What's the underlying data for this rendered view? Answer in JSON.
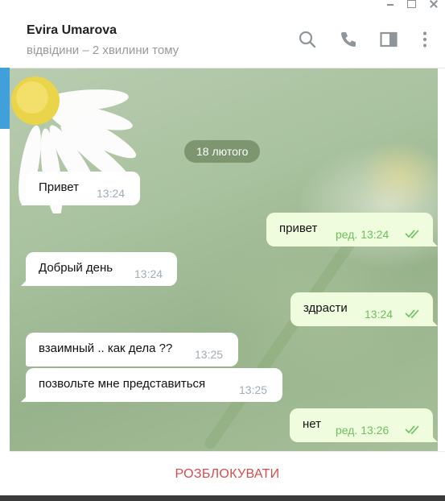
{
  "header": {
    "peer_name": "Evira Umarova",
    "peer_status": "відвідини – 2 хвилини тому"
  },
  "icons": {
    "search": "search-icon",
    "call": "phone-icon",
    "panel": "side-panel-icon",
    "more": "more-vertical-icon"
  },
  "chat": {
    "date": "18 лютого",
    "messages": [
      {
        "direction": "in",
        "text": "Привет",
        "time": "13:24"
      },
      {
        "direction": "out",
        "text": "привет",
        "time": "ред. 13:24",
        "read": true
      },
      {
        "direction": "in",
        "text": "Добрый день",
        "time": "13:24"
      },
      {
        "direction": "out",
        "text": "здрасти",
        "time": "13:24",
        "read": true
      },
      {
        "direction": "in",
        "text": "взаимный .. как дела ??",
        "time": "13:25"
      },
      {
        "direction": "in",
        "text": "позвольте мне представиться",
        "time": "13:25"
      },
      {
        "direction": "out",
        "text": "нет",
        "time": "ред. 13:26",
        "read": true
      }
    ]
  },
  "footer": {
    "unblock_label": "РОЗБЛОКУВАТИ"
  },
  "colors": {
    "accent": "#419fd9",
    "outgoing_bubble": "#effdde",
    "incoming_bubble": "#ffffff",
    "read_ticks": "#6cbf5b",
    "unblock": "#d14e4e"
  }
}
